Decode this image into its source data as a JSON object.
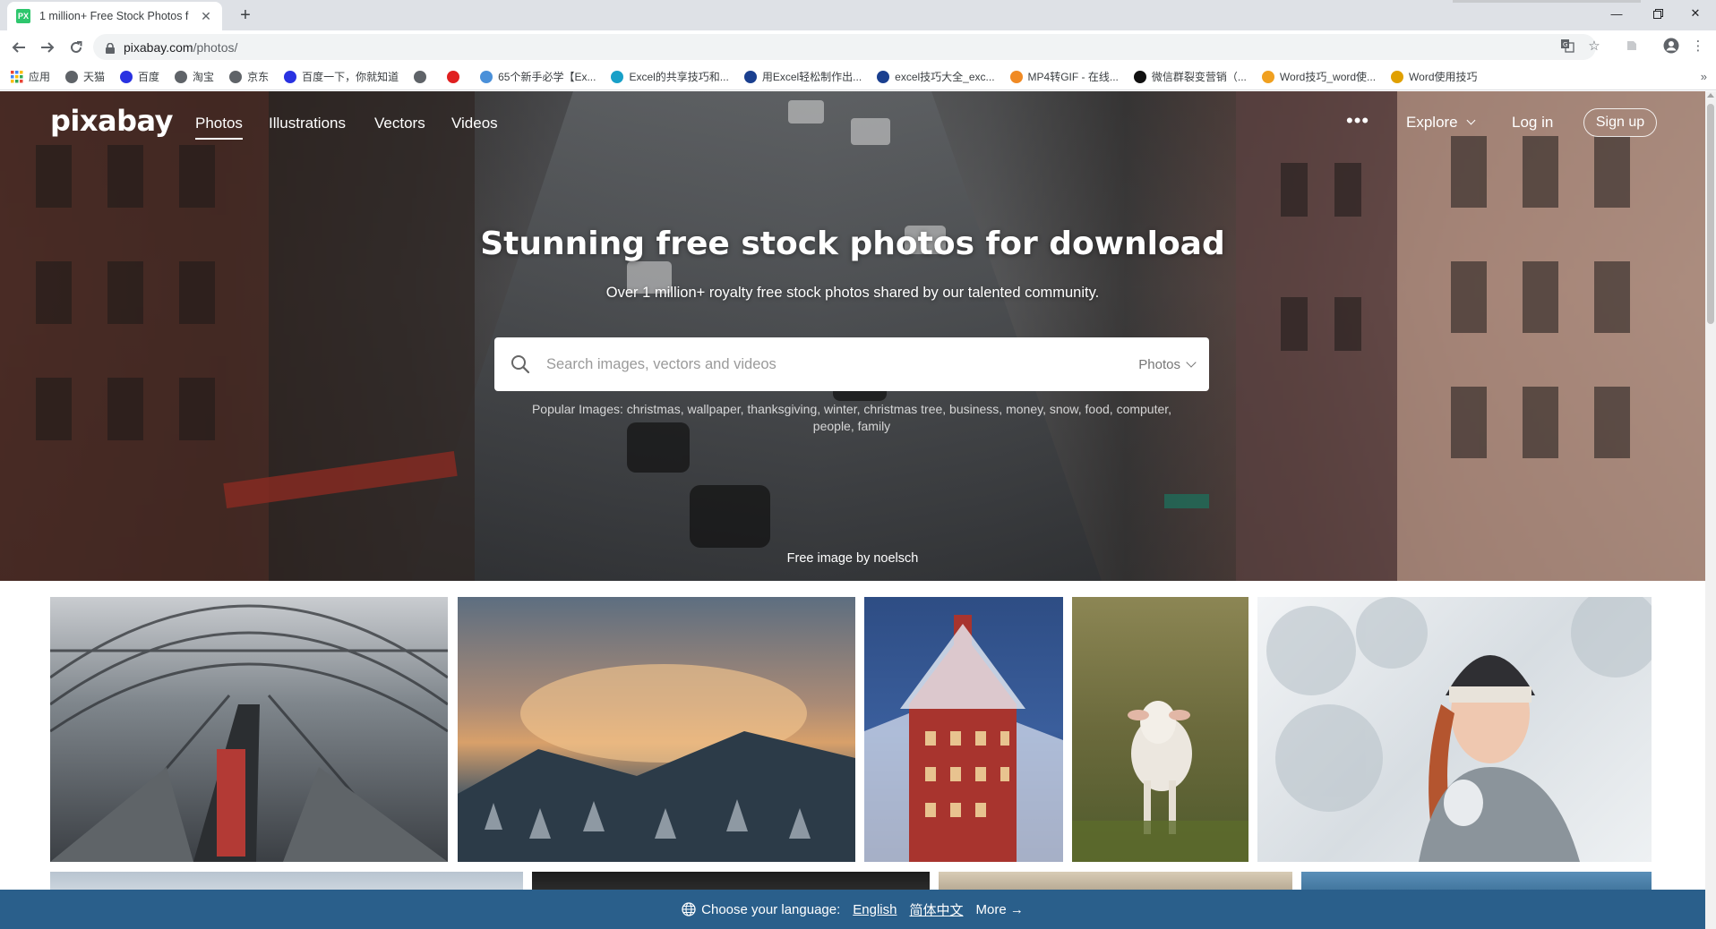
{
  "browser": {
    "tab_title": "1 million+ Free Stock Photos f",
    "tab_favicon": "PX",
    "url_host": "pixabay.com",
    "url_path": "/photos/",
    "bookmarks": [
      {
        "label": "应用",
        "icon": "apps-grid-icon",
        "color": "#4285f4"
      },
      {
        "label": "天猫",
        "icon": "globe-icon",
        "color": "#5f6368"
      },
      {
        "label": "百度",
        "icon": "baidu-paw-icon",
        "color": "#2932e1"
      },
      {
        "label": "淘宝",
        "icon": "globe-icon",
        "color": "#5f6368"
      },
      {
        "label": "京东",
        "icon": "globe-icon",
        "color": "#5f6368"
      },
      {
        "label": "百度一下，你就知道",
        "icon": "baidu-paw-icon",
        "color": "#2932e1"
      },
      {
        "label": "",
        "icon": "globe-icon",
        "color": "#5f6368"
      },
      {
        "label": "",
        "icon": "c-red-icon",
        "color": "#e02020"
      },
      {
        "label": "65个新手必学【Ex...",
        "icon": "doc-icon",
        "color": "#4a90d9"
      },
      {
        "label": "Excel的共享技巧和...",
        "icon": "e-circle-icon",
        "color": "#18a0c8"
      },
      {
        "label": "用Excel轻松制作出...",
        "icon": "shield-blue-icon",
        "color": "#1a3f8f"
      },
      {
        "label": "excel技巧大全_exc...",
        "icon": "shield-blue-icon",
        "color": "#1a3f8f"
      },
      {
        "label": "MP4转GIF - 在线...",
        "icon": "stack-orange-icon",
        "color": "#f08a24"
      },
      {
        "label": "微信群裂变营销（...",
        "icon": "m-black-icon",
        "color": "#111111"
      },
      {
        "label": "Word技巧_word使...",
        "icon": "grid-orange-icon",
        "color": "#f0a020"
      },
      {
        "label": "Word使用技巧",
        "icon": "tools-icon",
        "color": "#e0a000"
      }
    ]
  },
  "site": {
    "logo": "pixabay",
    "nav": [
      "Photos",
      "Illustrations",
      "Vectors",
      "Videos"
    ],
    "more_label": "•••",
    "explore_label": "Explore",
    "login_label": "Log in",
    "signup_label": "Sign up"
  },
  "hero": {
    "title": "Stunning free stock photos for download",
    "subtitle": "Over 1 million+ royalty free stock photos shared by our talented community.",
    "search_placeholder": "Search images, vectors and videos",
    "search_type": "Photos",
    "popular_prefix": "Popular Images:",
    "popular_terms": "christmas, wallpaper, thanksgiving, winter, christmas tree, business, money, snow, food, computer, people, family",
    "credit": "Free image by noelsch"
  },
  "gallery": {
    "photos": [
      {
        "name": "train-station-photo",
        "palette": [
          "#9aa0a4",
          "#3b3f44",
          "#c9ccd0"
        ]
      },
      {
        "name": "misty-forest-photo",
        "palette": [
          "#c78a56",
          "#5a6a7a",
          "#e8c9a0"
        ]
      },
      {
        "name": "winter-town-hall-photo",
        "palette": [
          "#3a5e9c",
          "#a8342e",
          "#dfe6f2"
        ]
      },
      {
        "name": "lamb-photo",
        "palette": [
          "#6b6a3c",
          "#e9e4dc",
          "#8a8048"
        ]
      },
      {
        "name": "winter-woman-photo",
        "palette": [
          "#e9edf0",
          "#9aa3aa",
          "#c46a4a"
        ]
      }
    ]
  },
  "language_bar": {
    "prompt": "Choose your language:",
    "options": [
      "English",
      "简体中文"
    ],
    "more": "More →"
  },
  "colors": {
    "accent_active_tab_favicon": "#2ec66d",
    "language_bar": "#2a5f8b"
  }
}
